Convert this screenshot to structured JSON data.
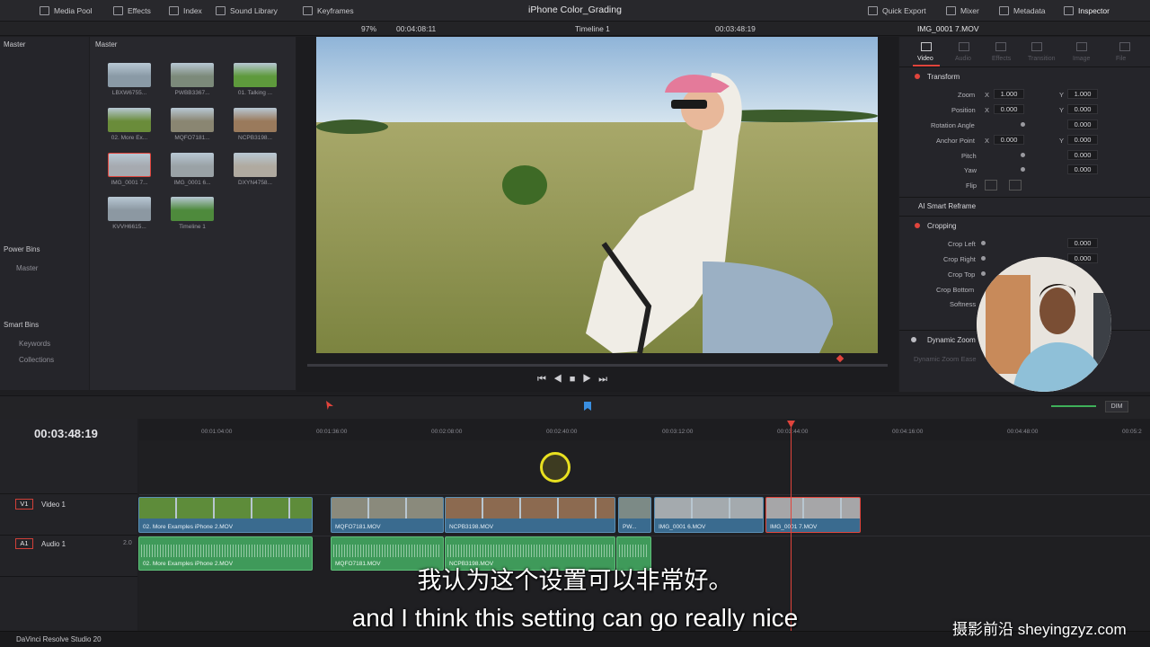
{
  "topbar": {
    "media_pool": "Media Pool",
    "effects": "Effects",
    "index": "Index",
    "sound_library": "Sound Library",
    "keyframes": "Keyframes",
    "project_title": "iPhone Color_Grading",
    "quick_export": "Quick Export",
    "mixer": "Mixer",
    "metadata": "Metadata",
    "inspector": "Inspector"
  },
  "viewer_bar": {
    "zoom": "97%",
    "source_timecode": "00:04:08:11",
    "timeline_name": "Timeline 1",
    "record_timecode": "00:03:48:19",
    "clip_name": "IMG_0001 7.MOV"
  },
  "media_pool": {
    "root": "Master",
    "bin_header": "Master",
    "power_bins": "Power Bins",
    "power_master": "Master",
    "smart_bins": "Smart Bins",
    "keywords": "Keywords",
    "collections": "Collections",
    "clips": [
      {
        "name": "LBXW6755...",
        "color": "#8a9aa6"
      },
      {
        "name": "PWBB3367...",
        "color": "#7c8a7a"
      },
      {
        "name": "01. Talking ...",
        "color": "#5e9a3c"
      },
      {
        "name": "02. More Ex...",
        "color": "#6a8c3a"
      },
      {
        "name": "MQFO7181...",
        "color": "#8a8672"
      },
      {
        "name": "NCPB3198...",
        "color": "#9a7a5c"
      },
      {
        "name": "IMG_0001 7...",
        "color": "#a6aab0"
      },
      {
        "name": "IMG_0001 6...",
        "color": "#9aa2a6"
      },
      {
        "name": "DXYN4758...",
        "color": "#b0aaa0"
      },
      {
        "name": "KVVH6615...",
        "color": "#8c98a2"
      },
      {
        "name": "Timeline 1",
        "color": "#4e8a3c"
      }
    ]
  },
  "inspector": {
    "tabs": [
      "Video",
      "Audio",
      "Effects",
      "Transition",
      "Image",
      "File"
    ],
    "transform": "Transform",
    "zoom_label": "Zoom",
    "zoom_x": "1.000",
    "zoom_y": "1.000",
    "position_label": "Position",
    "position_x": "0.000",
    "position_y": "0.000",
    "rotation_label": "Rotation Angle",
    "rotation": "0.000",
    "anchor_label": "Anchor Point",
    "anchor_x": "0.000",
    "anchor_y": "0.000",
    "pitch_label": "Pitch",
    "pitch": "0.000",
    "yaw_label": "Yaw",
    "yaw": "0.000",
    "flip_label": "Flip",
    "ai_reframe": "AI Smart Reframe",
    "cropping": "Cropping",
    "crop_left_label": "Crop Left",
    "crop_left": "0.000",
    "crop_right_label": "Crop Right",
    "crop_right": "0.000",
    "crop_top_label": "Crop Top",
    "crop_bottom_label": "Crop Bottom",
    "softness_label": "Softness",
    "dynamic_zoom": "Dynamic Zoom",
    "dynamic_zoom_ease": "Dynamic Zoom Ease",
    "x": "X",
    "y": "Y"
  },
  "timeline": {
    "timecode": "00:03:48:19",
    "ruler": [
      "00:01:04:00",
      "00:01:36:00",
      "00:02:08:00",
      "00:02:40:00",
      "00:03:12:00",
      "00:03:44:00",
      "00:04:16:00",
      "00:04:48:00",
      "00:05:2"
    ],
    "v1": "V1",
    "video1": "Video 1",
    "a1": "A1",
    "audio1": "Audio 1",
    "audio_level": "2.0",
    "dim": "DIM",
    "video_clips": [
      {
        "name": "02. More Examples iPhone 2.MOV",
        "color": "#5e8c3a"
      },
      {
        "name": "MQFO7181.MOV",
        "color": "#8a8a7c"
      },
      {
        "name": "NCPB3198.MOV",
        "color": "#8c6a50"
      },
      {
        "name": "PW...",
        "color": "#7c8a86"
      },
      {
        "name": "IMG_0001 6.MOV",
        "color": "#a4aaae"
      },
      {
        "name": "IMG_0001 7.MOV",
        "color": "#a6a6a8"
      }
    ],
    "audio_clips": [
      {
        "name": "02. More Examples iPhone 2.MOV"
      },
      {
        "name": "MQFO7181.MOV"
      },
      {
        "name": "NCPB3198.MOV"
      },
      {
        "name": ""
      }
    ]
  },
  "subtitles": {
    "chinese": "我认为这个设置可以非常好。",
    "english": "and I think this setting can go really nice"
  },
  "bottom": {
    "app_name": "DaVinci Resolve Studio 20"
  },
  "watermark": "摄影前沿 sheyingzyz.com"
}
